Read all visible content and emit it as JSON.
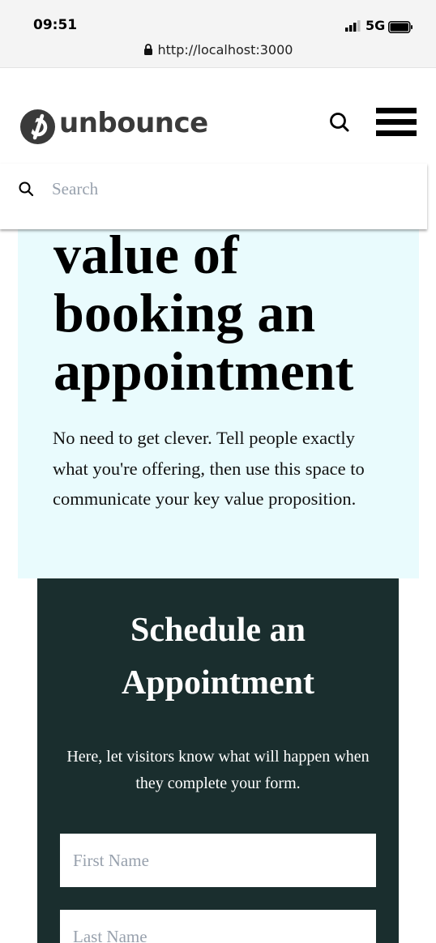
{
  "status_bar": {
    "time": "09:51",
    "network": "5G",
    "url": "http://localhost:3000"
  },
  "header": {
    "logo_text": "unbounce",
    "icons": [
      "search-icon",
      "hamburger-menu-icon"
    ]
  },
  "search": {
    "placeholder": "Search"
  },
  "hero": {
    "title_lines": [
      "value of",
      "booking an",
      "appointment"
    ],
    "body": "No need to get clever. Tell people exactly what you're offering, then use this space to communicate your key value proposition."
  },
  "form": {
    "title_lines": [
      "Schedule an",
      "Appointment"
    ],
    "description": "Here, let visitors know what will happen when they complete your form.",
    "first_name_placeholder": "First Name",
    "last_name_placeholder": "Last Name"
  },
  "colors": {
    "hero_background": "#e9fbfd",
    "form_background": "#1a2e2e",
    "logo_gray": "#3a3a3a"
  }
}
